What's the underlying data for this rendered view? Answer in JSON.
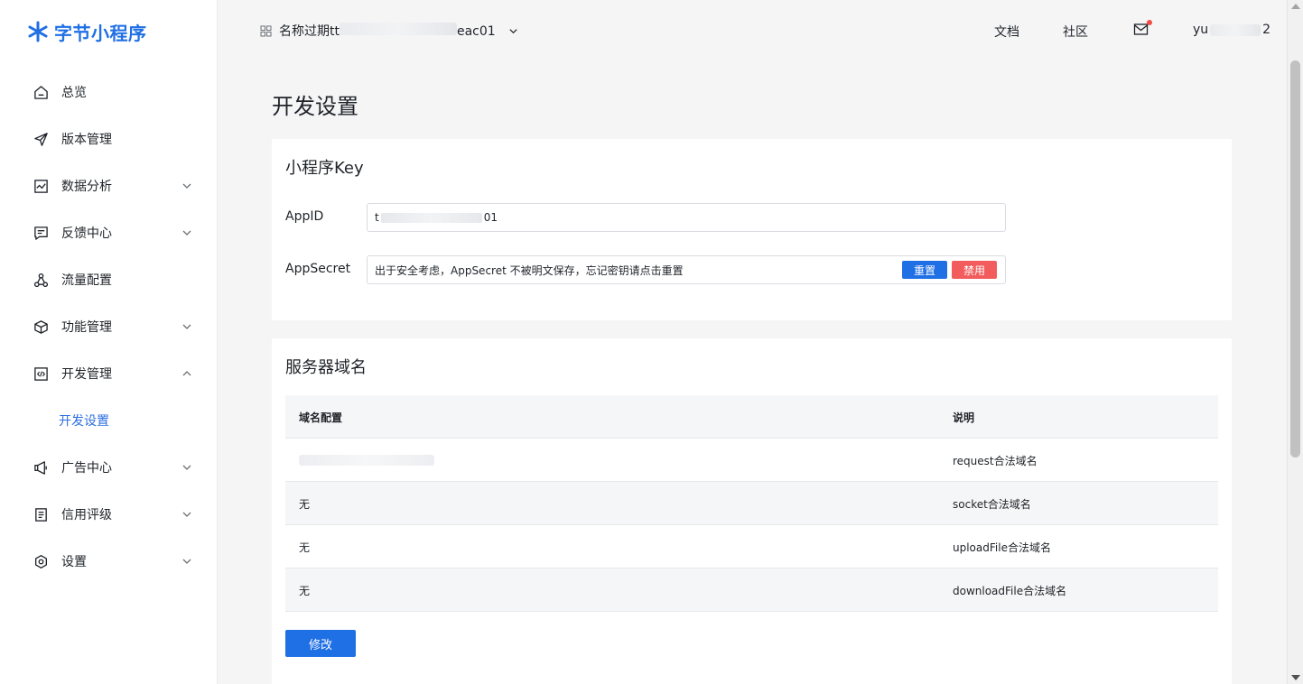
{
  "brand": {
    "name": "字节小程序",
    "color": "#1f6fe5"
  },
  "sidebar": {
    "items": [
      {
        "label": "总览",
        "icon": "home-icon",
        "has_children": false
      },
      {
        "label": "版本管理",
        "icon": "send-icon",
        "has_children": false
      },
      {
        "label": "数据分析",
        "icon": "chart-icon",
        "has_children": true
      },
      {
        "label": "反馈中心",
        "icon": "message-icon",
        "has_children": true
      },
      {
        "label": "流量配置",
        "icon": "share-icon",
        "has_children": false
      },
      {
        "label": "功能管理",
        "icon": "cube-icon",
        "has_children": true
      },
      {
        "label": "开发管理",
        "icon": "code-icon",
        "has_children": true,
        "expanded": true
      },
      {
        "label": "广告中心",
        "icon": "megaphone-icon",
        "has_children": true
      },
      {
        "label": "信用评级",
        "icon": "document-icon",
        "has_children": true
      },
      {
        "label": "设置",
        "icon": "gear-icon",
        "has_children": true
      }
    ],
    "sub_item_active": "开发设置"
  },
  "header": {
    "app_name_prefix": "名称过期tt",
    "app_name_suffix": "eac01",
    "links": {
      "docs": "文档",
      "community": "社区"
    },
    "user_prefix": "yu",
    "user_suffix": "2"
  },
  "page": {
    "title": "开发设置"
  },
  "key_card": {
    "title": "小程序Key",
    "appid_label": "AppID",
    "appid_prefix": "t",
    "appid_suffix": "01",
    "secret_label": "AppSecret",
    "secret_hint": "出于安全考虑，AppSecret 不被明文保存，忘记密钥请点击重置",
    "reset_label": "重置",
    "disable_label": "禁用"
  },
  "domain_card": {
    "title": "服务器域名",
    "headers": [
      "域名配置",
      "说明"
    ],
    "rows": [
      {
        "domain": "",
        "desc": "request合法域名"
      },
      {
        "domain": "无",
        "desc": "socket合法域名"
      },
      {
        "domain": "无",
        "desc": "uploadFile合法域名"
      },
      {
        "domain": "无",
        "desc": "downloadFile合法域名"
      }
    ],
    "modify_label": "修改"
  }
}
